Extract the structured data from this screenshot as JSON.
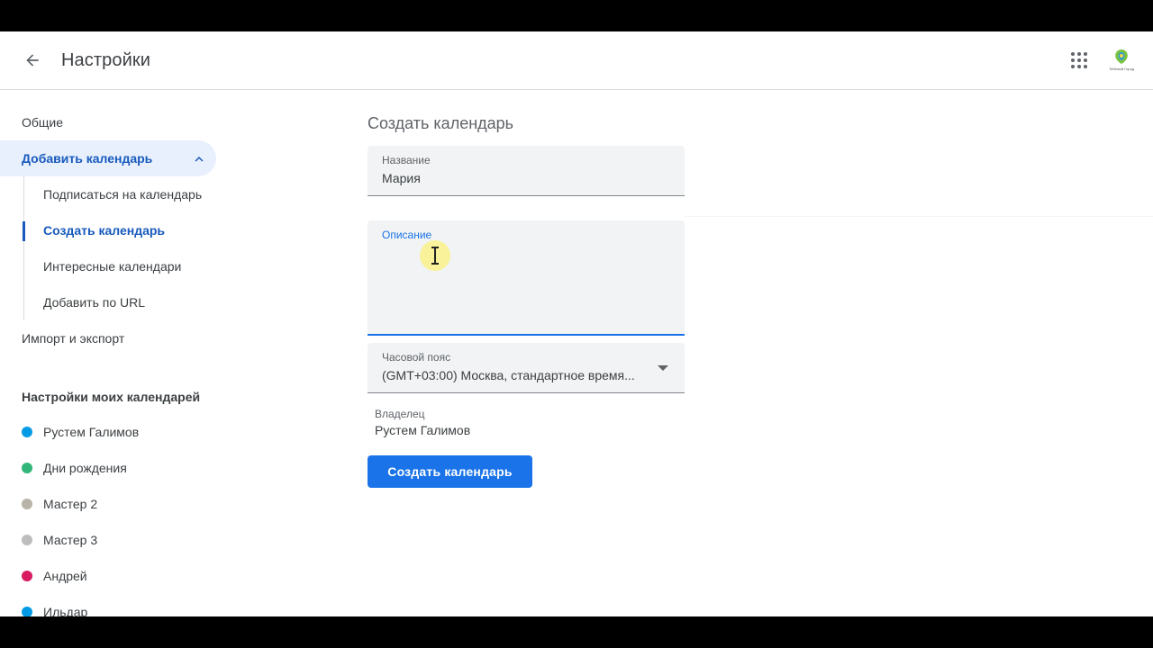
{
  "header": {
    "title": "Настройки",
    "back_icon": "arrow-back-icon",
    "apps_icon": "apps-grid-icon",
    "logo_text": "Тебеный Город",
    "logo_color_primary": "#7cc242",
    "logo_color_secondary": "#2b9cd8"
  },
  "sidebar": {
    "items": [
      {
        "label": "Общие"
      },
      {
        "label": "Добавить календарь",
        "active": true,
        "expanded": true
      },
      {
        "label": "Импорт и экспорт"
      }
    ],
    "sub_items": [
      {
        "label": "Подписаться на календарь"
      },
      {
        "label": "Создать календарь",
        "active": true
      },
      {
        "label": "Интересные календари"
      },
      {
        "label": "Добавить по URL"
      }
    ],
    "my_calendars_heading": "Настройки моих календарей",
    "calendars": [
      {
        "label": "Рустем Галимов",
        "color": "#039be5"
      },
      {
        "label": "Дни рождения",
        "color": "#33b679"
      },
      {
        "label": "Мастер 2",
        "color": "#b9b3a7"
      },
      {
        "label": "Мастер 3",
        "color": "#bdbdbd"
      },
      {
        "label": "Андрей",
        "color": "#d81b60"
      },
      {
        "label": "Ильдар",
        "color": "#039be5"
      }
    ]
  },
  "main": {
    "heading": "Создать календарь",
    "name_field": {
      "label": "Название",
      "value": "Мария"
    },
    "description_field": {
      "label": "Описание",
      "value": ""
    },
    "timezone_field": {
      "label": "Часовой пояс",
      "value": "(GMT+03:00) Москва, стандартное время..."
    },
    "owner": {
      "label": "Владелец",
      "value": "Рустем Галимов"
    },
    "submit_label": "Создать календарь"
  },
  "colors": {
    "accent": "#1a73e8",
    "active_nav_bg": "#e8f0fe",
    "active_nav_text": "#185abc"
  }
}
